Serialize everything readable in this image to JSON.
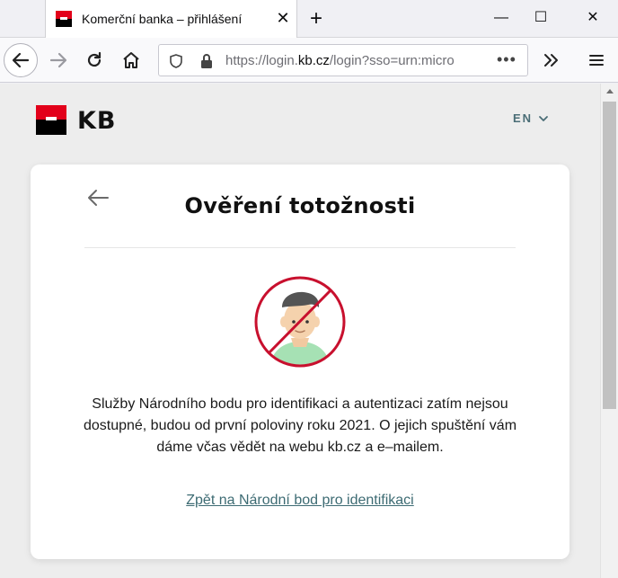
{
  "browser": {
    "tab_title": "Komerční banka – přihlášení",
    "url_prefix": "https://login.",
    "url_domain": "kb.cz",
    "url_rest": "/login?sso=urn:micro",
    "new_tab_label": "+",
    "close_tab_label": "✕",
    "url_more_label": "•••",
    "window_controls": {
      "minimize": "—",
      "maximize": "☐",
      "close": "✕"
    }
  },
  "page": {
    "brand": "KB",
    "language": "EN",
    "card": {
      "title": "Ověření totožnosti",
      "message": "Služby Národního bodu pro identifikaci a autentizaci zatím nejsou dostupné, budou od první poloviny roku 2021. O jejich spuštění vám dáme včas vědět na webu kb.cz a e–mailem.",
      "link": "Zpět na Národní bod pro identifikaci"
    }
  },
  "colors": {
    "brand_red": "#e2001a",
    "link": "#3d6b73",
    "forbidden_red": "#c8102e"
  }
}
